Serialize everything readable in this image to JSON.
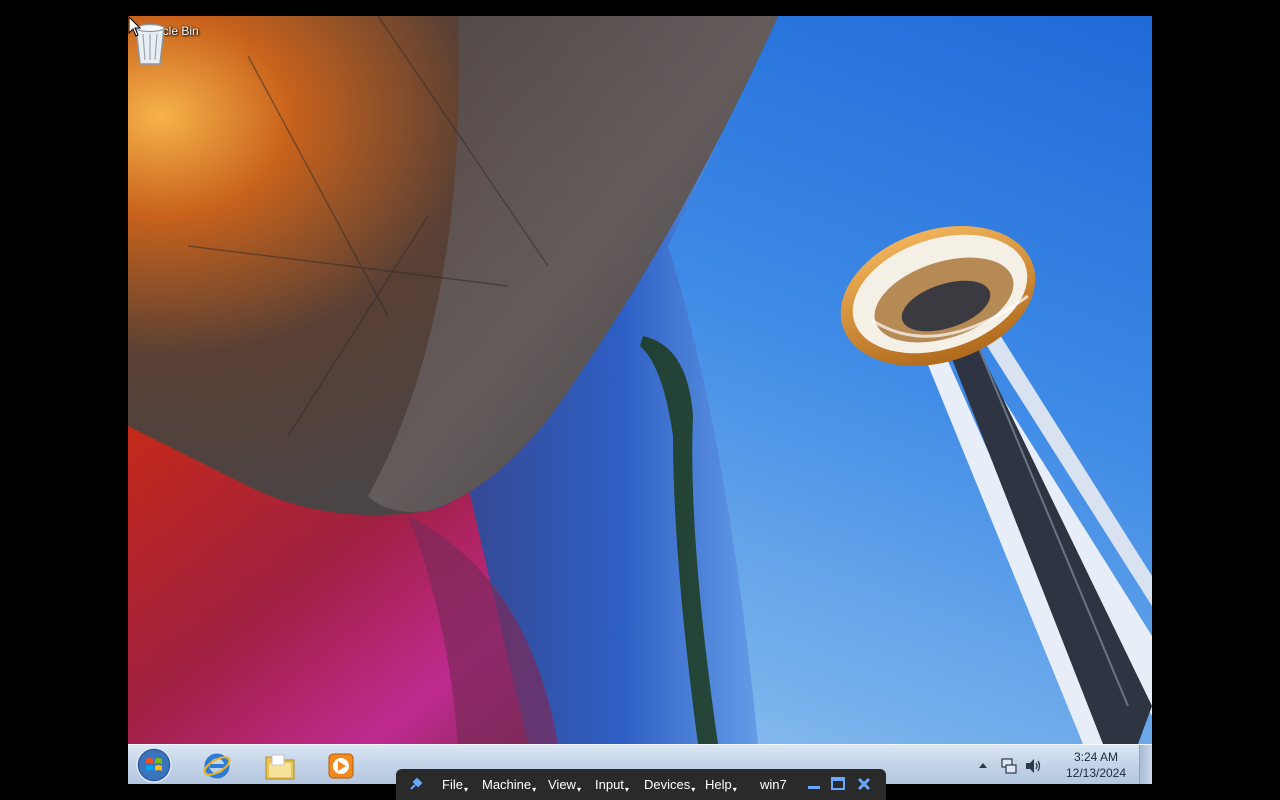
{
  "desktop": {
    "icons": [
      {
        "label": "Recycle Bin",
        "icon": "recycle-bin-icon"
      }
    ]
  },
  "taskbar": {
    "start": {
      "icon": "windows-start-orb-icon"
    },
    "pinned": [
      {
        "name": "Internet Explorer",
        "icon": "internet-explorer-icon"
      },
      {
        "name": "Windows Explorer",
        "icon": "folder-icon"
      },
      {
        "name": "Windows Media Player",
        "icon": "media-player-icon"
      }
    ],
    "tray": {
      "icons": [
        "show-hidden-icons-icon",
        "network-icon",
        "volume-icon"
      ],
      "time": "3:24 AM",
      "date": "12/13/2024"
    }
  },
  "mini_toolbar": {
    "menus": [
      "File",
      "Machine",
      "View",
      "Input",
      "Devices",
      "Help"
    ],
    "machine_name": "win7",
    "icons": [
      "pin-icon",
      "minimize-icon",
      "restore-icon",
      "close-icon"
    ]
  },
  "colors": {
    "taskbar": "#c4d4e8",
    "mini_toolbar": "#2a2a2a",
    "sky": "#3f8be6"
  }
}
